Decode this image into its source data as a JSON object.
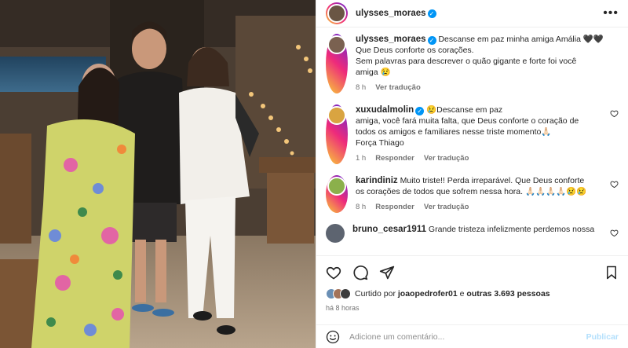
{
  "post": {
    "author": "ulysses_moraes",
    "more_label": "•••"
  },
  "comments": [
    {
      "user": "ulysses_moraes",
      "verified": true,
      "lines": [
        "Descanse em paz minha amiga Amália 🖤🖤",
        "Que Deus conforte os corações.",
        "Sem palavras para descrever o quão gigante e forte foi você",
        "amiga 😢"
      ],
      "time": "8 h",
      "actions": [
        "Ver tradução"
      ],
      "avatar_color": "#7a6150"
    },
    {
      "user": "xuxudalmolin",
      "verified": true,
      "lines": [
        "😢Descanse em paz",
        "amiga, você fará muita falta, que Deus conforte o coração de",
        "todos os amigos e familiares nesse triste momento🙏🏻",
        "Força Thiago"
      ],
      "time": "1 h",
      "actions": [
        "Responder",
        "Ver tradução"
      ],
      "avatar_color": "#d9a441"
    },
    {
      "user": "karindiniz",
      "verified": false,
      "lines": [
        "Muito triste!! Perda irreparável. Que Deus conforte",
        "os corações de todos que sofrem nessa hora. 🙏🏻🙏🏻🙏🏻🙏🏻😢😢"
      ],
      "time": "8 h",
      "actions": [
        "Responder",
        "Ver tradução"
      ],
      "avatar_color": "#8bb04b"
    },
    {
      "user": "bruno_cesar1911",
      "verified": false,
      "lines": [
        "Grande tristeza infelizmente perdemos nossa"
      ],
      "time": "",
      "actions": [],
      "avatar_color": "#5d6470"
    }
  ],
  "likes": {
    "prefix": "Curtido por",
    "user": "joaopedrofer01",
    "connector": "e",
    "others": "outras 3.693 pessoas"
  },
  "time_ago": "há 8 horas",
  "add_comment": {
    "placeholder": "Adicione um comentário...",
    "publish": "Publicar"
  },
  "icons": [
    "heart-icon",
    "comment-icon",
    "share-icon",
    "save-icon",
    "emoji-icon"
  ]
}
